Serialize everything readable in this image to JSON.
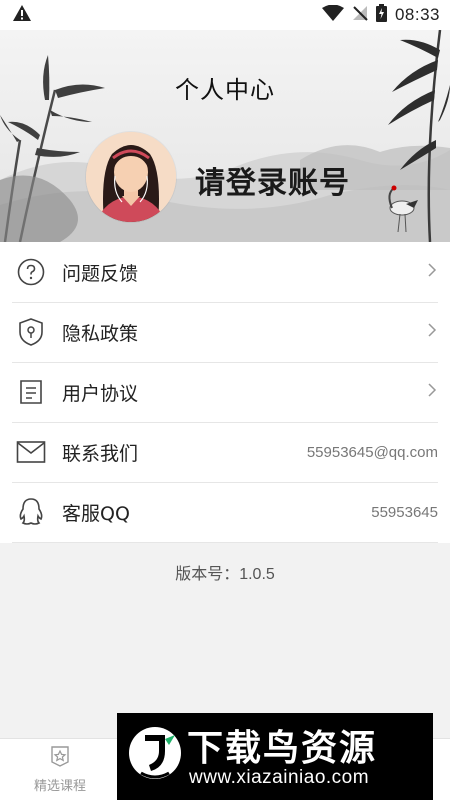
{
  "status_bar": {
    "time": "08:33",
    "icons": [
      "warning-icon",
      "wifi-icon",
      "no-signal-icon",
      "battery-icon"
    ]
  },
  "header": {
    "title": "个人中心",
    "login_text": "请登录账号",
    "avatar_icon": "girl-avatar-icon"
  },
  "menu": {
    "items": [
      {
        "label": "问题反馈",
        "icon": "question-circle-icon",
        "value": "",
        "chevron": true
      },
      {
        "label": "隐私政策",
        "icon": "shield-icon",
        "value": "",
        "chevron": true
      },
      {
        "label": "用户协议",
        "icon": "document-icon",
        "value": "",
        "chevron": true
      },
      {
        "label": "联系我们",
        "icon": "mail-icon",
        "value": "55953645@qq.com",
        "chevron": false
      },
      {
        "label": "客服QQ",
        "icon": "qq-icon",
        "value": "55953645",
        "chevron": false
      }
    ]
  },
  "version": {
    "label": "版本号：",
    "number": "1.0.5"
  },
  "tabbar": {
    "tabs": [
      {
        "label": "精选课程",
        "icon": "star-badge-icon"
      }
    ]
  },
  "watermark": {
    "title": "下载鸟资源",
    "url": "www.xiazainiao.com"
  },
  "colors": {
    "background": "#f2f2f2",
    "text": "#222222",
    "secondary_text": "#777777",
    "divider": "#e6e6e6"
  }
}
